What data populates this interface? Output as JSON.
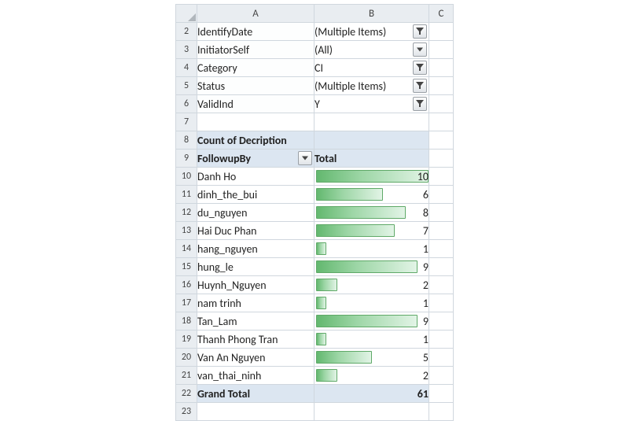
{
  "headers": {
    "corner": "",
    "colA": "A",
    "colB": "B",
    "colC": "C"
  },
  "filters": [
    {
      "row": "2",
      "label": "IdentifyDate",
      "value": "(Multiple Items)",
      "icon": "funnel"
    },
    {
      "row": "3",
      "label": "InitiatorSelf",
      "value": "(All)",
      "icon": "chevron"
    },
    {
      "row": "4",
      "label": "Category",
      "value": "CI",
      "icon": "funnel"
    },
    {
      "row": "5",
      "label": "Status",
      "value": "(Multiple Items)",
      "icon": "funnel"
    },
    {
      "row": "6",
      "label": "ValidInd",
      "value": "Y",
      "icon": "funnel"
    }
  ],
  "blank_rows": {
    "r7": "7",
    "r23": "23"
  },
  "pivot": {
    "title_row": "8",
    "title": "Count of Decription",
    "header_row": "9",
    "rowfield": "FollowupBy",
    "valfield": "Total",
    "rows": [
      {
        "row": "10",
        "name": "Danh Ho",
        "value": 10
      },
      {
        "row": "11",
        "name": "dinh_the_bui",
        "value": 6
      },
      {
        "row": "12",
        "name": "du_nguyen",
        "value": 8
      },
      {
        "row": "13",
        "name": "Hai Duc Phan",
        "value": 7
      },
      {
        "row": "14",
        "name": "hang_nguyen",
        "value": 1
      },
      {
        "row": "15",
        "name": "hung_le",
        "value": 9
      },
      {
        "row": "16",
        "name": "Huynh_Nguyen",
        "value": 2
      },
      {
        "row": "17",
        "name": "nam trinh",
        "value": 1
      },
      {
        "row": "18",
        "name": "Tan_Lam",
        "value": 9
      },
      {
        "row": "19",
        "name": "Thanh Phong Tran",
        "value": 1
      },
      {
        "row": "20",
        "name": "Van An Nguyen",
        "value": 5
      },
      {
        "row": "21",
        "name": "van_thai_ninh",
        "value": 2
      }
    ],
    "total_row": "22",
    "total_label": "Grand Total",
    "total_value": 61
  },
  "chart_data": {
    "type": "bar",
    "title": "Count of Decription",
    "xlabel": "Total",
    "ylabel": "FollowupBy",
    "categories": [
      "Danh Ho",
      "dinh_the_bui",
      "du_nguyen",
      "Hai Duc Phan",
      "hang_nguyen",
      "hung_le",
      "Huynh_Nguyen",
      "nam trinh",
      "Tan_Lam",
      "Thanh Phong Tran",
      "Van An Nguyen",
      "van_thai_ninh"
    ],
    "values": [
      10,
      6,
      8,
      7,
      1,
      9,
      2,
      1,
      9,
      1,
      5,
      2
    ],
    "total": 61,
    "ylim": [
      0,
      10
    ]
  }
}
